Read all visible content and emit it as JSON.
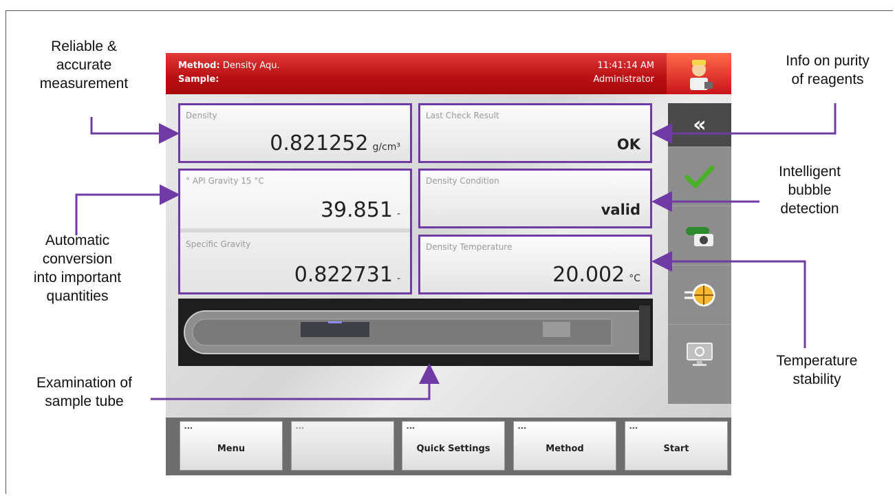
{
  "callouts": {
    "reliable": [
      "Reliable &",
      "accurate",
      "measurement"
    ],
    "purity": [
      "Info on purity",
      "of reagents"
    ],
    "bubble": [
      "Intelligent",
      "bubble",
      "detection"
    ],
    "conversion": [
      "Automatic",
      "conversion",
      "into important",
      "quantities"
    ],
    "temperature": [
      "Temperature",
      "stability"
    ],
    "tube": [
      "Examination of",
      "sample tube"
    ]
  },
  "header": {
    "method_label": "Method:",
    "method_value": "Density Aqu.",
    "sample_label": "Sample:",
    "sample_value": "",
    "time": "11:41:14 AM",
    "user": "Administrator",
    "user_icon": "user-avatar-icon"
  },
  "tiles": {
    "density": {
      "label": "Density",
      "value": "0.821252",
      "unit": "g/cm³"
    },
    "last_check": {
      "label": "Last Check Result",
      "value": "OK"
    },
    "api_gravity": {
      "label": "° API Gravity 15 °C",
      "value": "39.851",
      "unit": "-"
    },
    "specific_gravity": {
      "label": "Specific Gravity",
      "value": "0.822731",
      "unit": "-"
    },
    "density_condition": {
      "label": "Density Condition",
      "value": "valid"
    },
    "density_temperature": {
      "label": "Density Temperature",
      "value": "20.002",
      "unit": "°C"
    }
  },
  "sidebar": {
    "collapse_label": "«",
    "items": [
      "collapse-icon",
      "checkmark-icon",
      "camera-icon",
      "target-icon",
      "monitor-icon"
    ]
  },
  "function_buttons": [
    {
      "label": "Menu"
    },
    {
      "label": ""
    },
    {
      "label": "Quick Settings"
    },
    {
      "label": "Method"
    },
    {
      "label": "Start"
    }
  ],
  "colors": {
    "header_red": "#b80f12",
    "annotation_purple": "#6f3aa3",
    "check_green": "#4caf2a"
  }
}
